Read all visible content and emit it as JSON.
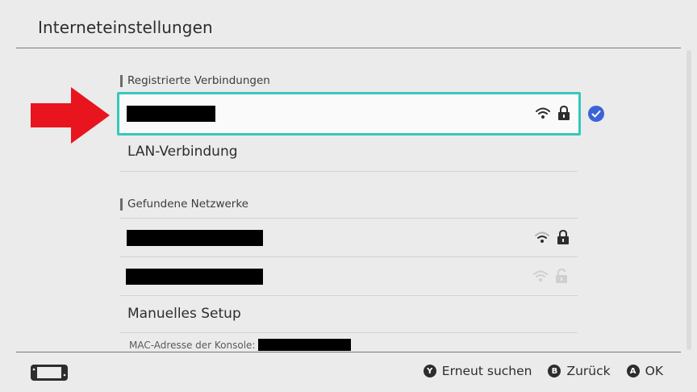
{
  "header": {
    "title": "Interneteinstellungen"
  },
  "registered": {
    "section_label": "Registrierte Verbindungen",
    "lan_label": "LAN-Verbindung"
  },
  "found": {
    "section_label": "Gefundene Netzwerke"
  },
  "manual_setup_label": "Manuelles Setup",
  "mac_label": "MAC-Adresse der Konsole:",
  "footer": {
    "search": {
      "key": "Y",
      "label": "Erneut suchen"
    },
    "back": {
      "key": "B",
      "label": "Zurück"
    },
    "ok": {
      "key": "A",
      "label": "OK"
    }
  },
  "colors": {
    "selection_border": "#36c8be",
    "check_blue": "#3c62d8",
    "arrow_red": "#e8141e"
  },
  "icons": {
    "wifi": "wifi-icon",
    "lock": "lock-icon",
    "unlock": "unlock-icon",
    "check": "check-icon",
    "arrow": "arrow-right-icon",
    "console": "console-icon"
  }
}
